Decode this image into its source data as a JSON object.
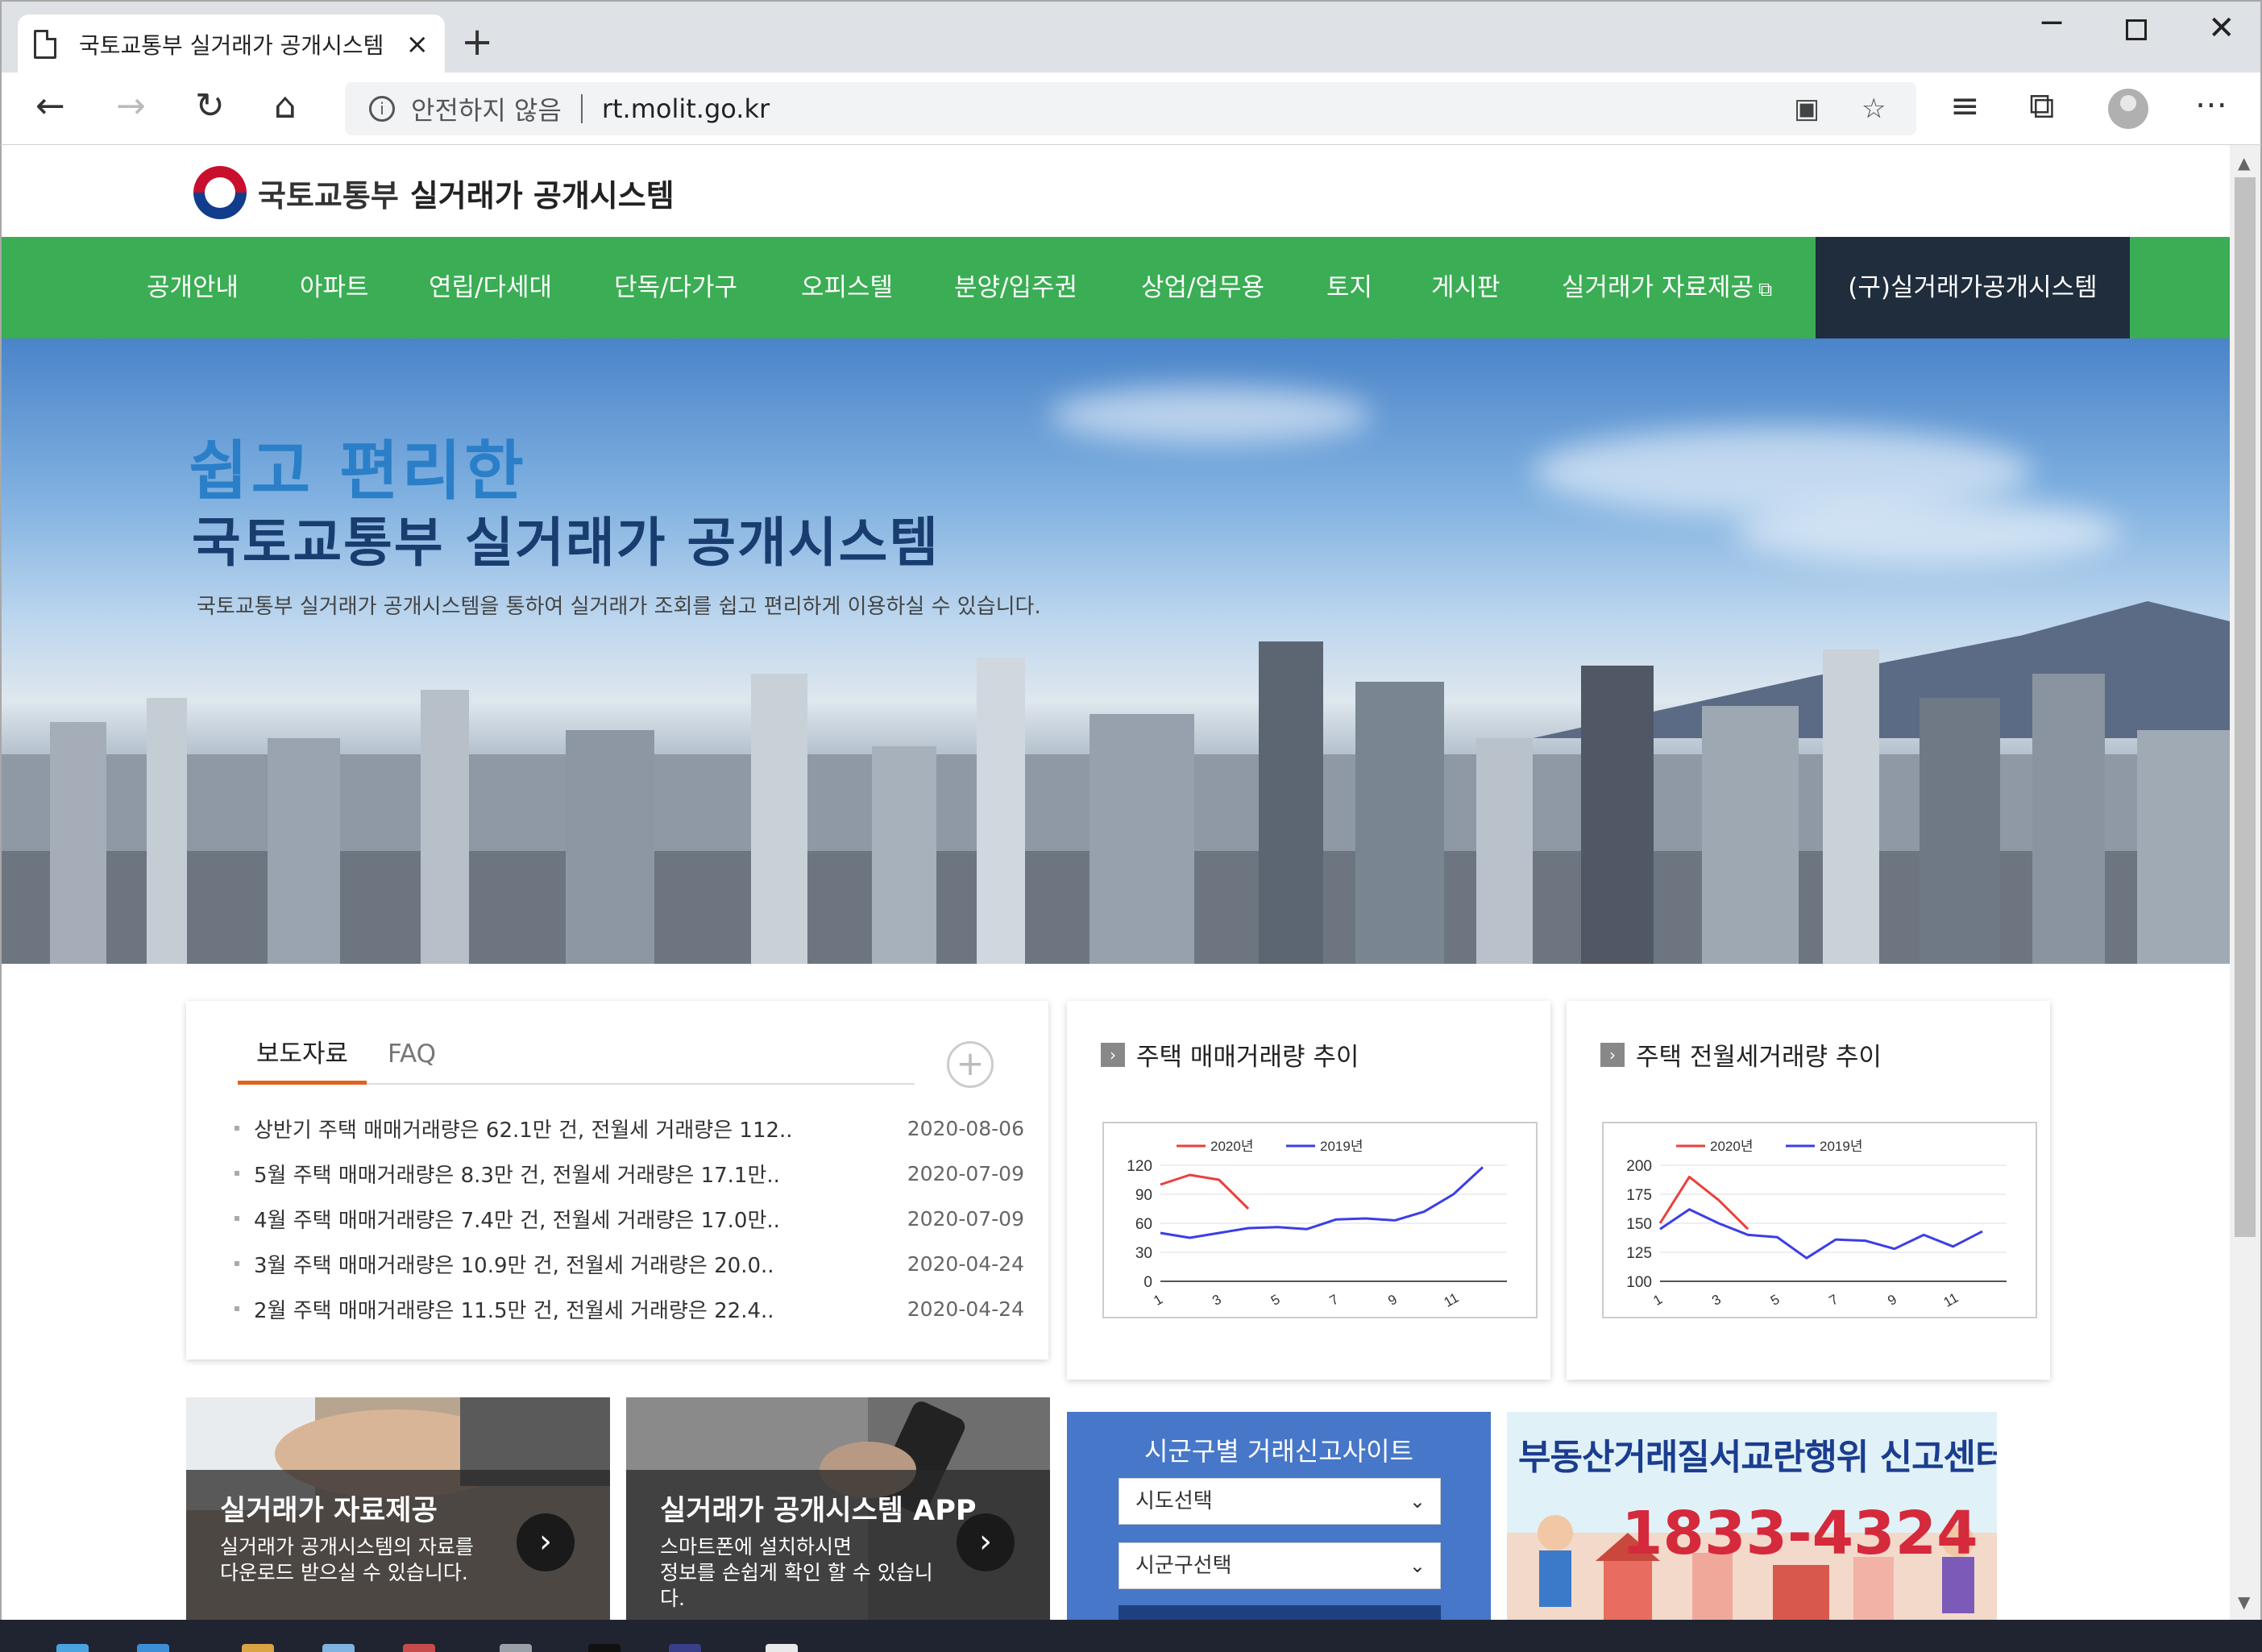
{
  "browser": {
    "tab_title": "국토교통부 실거래가 공개시스템",
    "new_tab": "+",
    "tab_close": "×",
    "security_warning": "안전하지 않음",
    "url": "rt.molit.go.kr",
    "info_icon": "i"
  },
  "site": {
    "ministry": "국토교통부",
    "system_name": "실거래가 공개시스템"
  },
  "nav": {
    "items": [
      "공개안내",
      "아파트",
      "연립/다세대",
      "단독/다가구",
      "오피스텔",
      "분양/입주권",
      "상업/업무용",
      "토지",
      "게시판",
      "실거래가 자료제공"
    ],
    "legacy": "(구)실거래가공개시스템"
  },
  "hero": {
    "slogan": "쉽고 편리한",
    "title": "국토교통부 실거래가 공개시스템",
    "description": "국토교통부 실거래가 공개시스템을 통하여 실거래가 조회를 쉽고 편리하게 이용하실 수 있습니다."
  },
  "news": {
    "tab_press": "보도자료",
    "tab_faq": "FAQ",
    "more": "+",
    "items": [
      {
        "title": "상반기 주택 매매거래량은 62.1만 건, 전월세 거래량은 112..",
        "date": "2020-08-06"
      },
      {
        "title": "5월 주택 매매거래량은 8.3만 건, 전월세 거래량은 17.1만..",
        "date": "2020-07-09"
      },
      {
        "title": "4월 주택 매매거래량은 7.4만 건, 전월세 거래량은 17.0만..",
        "date": "2020-07-09"
      },
      {
        "title": "3월 주택 매매거래량은 10.9만 건, 전월세 거래량은 20.0..",
        "date": "2020-04-24"
      },
      {
        "title": "2월 주택 매매거래량은 11.5만 건, 전월세 거래량은 22.4..",
        "date": "2020-04-24"
      }
    ]
  },
  "chart_data": [
    {
      "type": "line",
      "title": "주택 매매거래량 추이",
      "x": [
        1,
        2,
        3,
        4,
        5,
        6,
        7,
        8,
        9,
        10,
        11,
        12
      ],
      "x_ticks": [
        "1",
        "3",
        "5",
        "7",
        "9",
        "11"
      ],
      "y_ticks": [
        "120",
        "90",
        "60",
        "30",
        "0"
      ],
      "ylim": [
        0,
        120
      ],
      "legend_position": "top-left",
      "series": [
        {
          "name": "2020년",
          "color": "#e8413c",
          "values": [
            100,
            110,
            105,
            75
          ]
        },
        {
          "name": "2019년",
          "color": "#3b3ee8",
          "values": [
            50,
            45,
            50,
            55,
            56,
            54,
            64,
            65,
            63,
            72,
            90,
            118
          ]
        }
      ]
    },
    {
      "type": "line",
      "title": "주택 전월세거래량 추이",
      "x": [
        1,
        2,
        3,
        4,
        5,
        6,
        7,
        8,
        9,
        10,
        11,
        12
      ],
      "x_ticks": [
        "1",
        "3",
        "5",
        "7",
        "9",
        "11"
      ],
      "y_ticks": [
        "200",
        "175",
        "150",
        "125",
        "100"
      ],
      "ylim": [
        100,
        200
      ],
      "legend_position": "top-left",
      "series": [
        {
          "name": "2020년",
          "color": "#e8413c",
          "values": [
            150,
            190,
            170,
            145
          ]
        },
        {
          "name": "2019년",
          "color": "#3b3ee8",
          "values": [
            145,
            162,
            150,
            140,
            138,
            120,
            136,
            135,
            128,
            140,
            130,
            143
          ]
        }
      ]
    }
  ],
  "promos": [
    {
      "title": "실거래가 자료제공",
      "line1": "실거래가 공개시스템의 자료를",
      "line2": "다운로드 받으실 수 있습니다."
    },
    {
      "title": "실거래가 공개시스템 APP",
      "line1": "스마트폰에 설치하시면",
      "line2": "정보를 손쉽게 확인 할 수 있습니다."
    }
  ],
  "local": {
    "title": "시군구별 거래신고사이트",
    "sido_placeholder": "시도선택",
    "sigungu_placeholder": "시군구선택"
  },
  "report": {
    "title": "부동산거래질서교란행위 신고센터",
    "phone": "1833-4324"
  },
  "colors": {
    "nav_green": "#3bad54",
    "nav_dark": "#1f2d3d",
    "tab_accent": "#e2621b",
    "local_blue": "#4677c8",
    "report_red": "#d42a3c"
  }
}
